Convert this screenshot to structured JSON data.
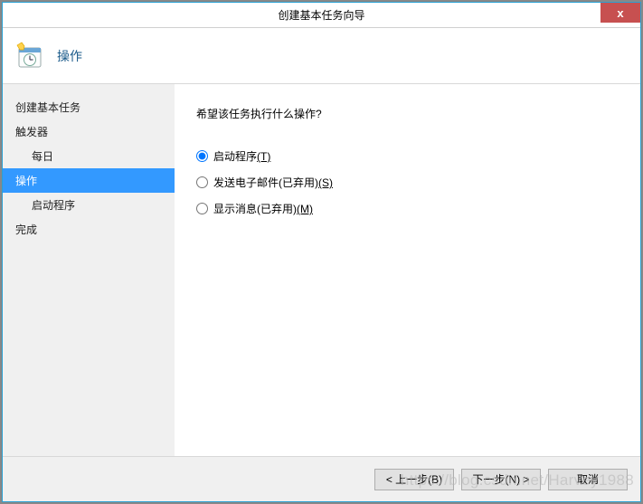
{
  "window": {
    "title": "创建基本任务向导",
    "close": "x"
  },
  "header": {
    "title": "操作"
  },
  "sidebar": {
    "items": [
      {
        "label": "创建基本任务",
        "sub": false,
        "active": false
      },
      {
        "label": "触发器",
        "sub": false,
        "active": false
      },
      {
        "label": "每日",
        "sub": true,
        "active": false
      },
      {
        "label": "操作",
        "sub": false,
        "active": true
      },
      {
        "label": "启动程序",
        "sub": true,
        "active": false
      },
      {
        "label": "完成",
        "sub": false,
        "active": false
      }
    ]
  },
  "content": {
    "prompt": "希望该任务执行什么操作?",
    "options": [
      {
        "label": "启动程序",
        "accel": "(T)",
        "checked": true
      },
      {
        "label": "发送电子邮件(已弃用)",
        "accel": "(S)",
        "checked": false
      },
      {
        "label": "显示消息(已弃用)",
        "accel": "(M)",
        "checked": false
      }
    ]
  },
  "footer": {
    "back": "< 上一步(B)",
    "next": "下一步(N) >",
    "cancel": "取消"
  },
  "watermark": "https://blog.csdn.net/Harvey1988"
}
